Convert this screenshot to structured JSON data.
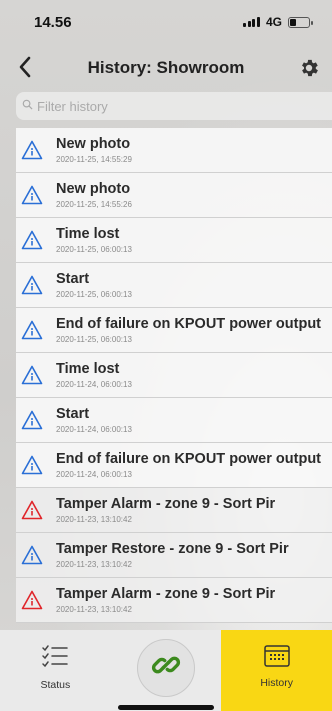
{
  "status_bar": {
    "time": "14.56",
    "network": "4G"
  },
  "nav": {
    "title": "History: Showroom",
    "back_icon": "chevron-left-icon",
    "settings_icon": "gear-icon"
  },
  "search": {
    "placeholder": "Filter history",
    "value": ""
  },
  "history": {
    "items": [
      {
        "title": "New photo",
        "date": "2020-11-25, 14:55:29",
        "level": "info"
      },
      {
        "title": "New photo",
        "date": "2020-11-25, 14:55:26",
        "level": "info"
      },
      {
        "title": "Time lost",
        "date": "2020-11-25, 06:00:13",
        "level": "info"
      },
      {
        "title": "Start",
        "date": "2020-11-25, 06:00:13",
        "level": "info"
      },
      {
        "title": "End of failure on KPOUT power output",
        "date": "2020-11-25, 06:00:13",
        "level": "info"
      },
      {
        "title": "Time lost",
        "date": "2020-11-24, 06:00:13",
        "level": "info"
      },
      {
        "title": "Start",
        "date": "2020-11-24, 06:00:13",
        "level": "info"
      },
      {
        "title": "End of failure on KPOUT power output",
        "date": "2020-11-24, 06:00:13",
        "level": "info"
      },
      {
        "title": "Tamper Alarm - zone 9 - Sort Pir",
        "date": "2020-11-23, 13:10:42",
        "level": "alarm"
      },
      {
        "title": "Tamper Restore - zone 9 - Sort Pir",
        "date": "2020-11-23, 13:10:42",
        "level": "info"
      },
      {
        "title": "Tamper Alarm - zone 9 - Sort Pir",
        "date": "2020-11-23, 13:10:42",
        "level": "alarm"
      }
    ]
  },
  "tabbar": {
    "status_label": "Status",
    "history_label": "History",
    "active_color": "#f9d714"
  },
  "colors": {
    "info": "#2a6fd6",
    "alarm": "#e0262b"
  }
}
